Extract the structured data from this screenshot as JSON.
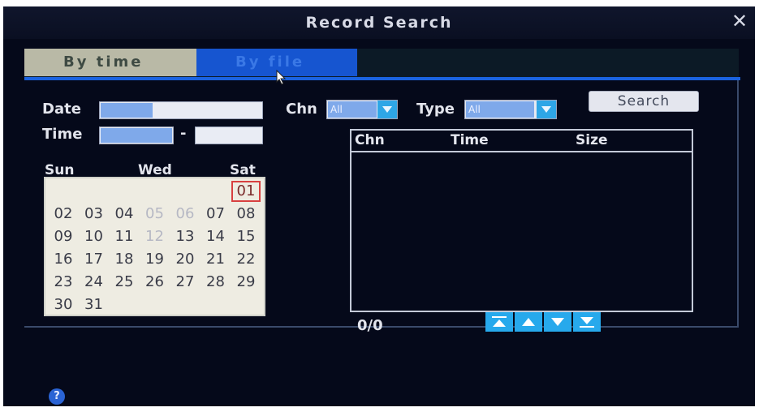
{
  "window": {
    "title": "Record Search",
    "close_label": "✕"
  },
  "tabs": [
    {
      "label": "By time",
      "active": true
    },
    {
      "label": "By file",
      "active": false
    }
  ],
  "form": {
    "date_label": "Date",
    "time_label": "Time",
    "time_separator": "-",
    "chn_label": "Chn",
    "chn_value": "All",
    "type_label": "Type",
    "type_value": "All",
    "search_label": "Search"
  },
  "calendar": {
    "headers": [
      "Sun",
      "Wed",
      "Sat"
    ],
    "selected_day": "01",
    "weeks": [
      [
        "",
        "",
        "",
        "",
        "",
        "",
        "01"
      ],
      [
        "02",
        "03",
        "04",
        "05",
        "06",
        "07",
        "08"
      ],
      [
        "09",
        "10",
        "11",
        "12",
        "13",
        "14",
        "15"
      ],
      [
        "16",
        "17",
        "18",
        "19",
        "20",
        "21",
        "22"
      ],
      [
        "23",
        "24",
        "25",
        "26",
        "27",
        "28",
        "29"
      ],
      [
        "30",
        "31",
        "",
        "",
        "",
        "",
        ""
      ]
    ],
    "dim_days": [
      "05",
      "06",
      "12"
    ]
  },
  "file_list": {
    "columns": [
      "Chn",
      "Time",
      "Size"
    ],
    "rows": [],
    "page_count": "0/0"
  },
  "colors": {
    "accent": "#1b63e0",
    "button_cyan": "#27a9ec",
    "background": "#05091a"
  },
  "icons": [
    "close-icon",
    "cursor-icon",
    "dropdown-arrow-icon",
    "first-page-icon",
    "prev-page-icon",
    "next-page-icon",
    "last-page-icon",
    "help-icon"
  ]
}
